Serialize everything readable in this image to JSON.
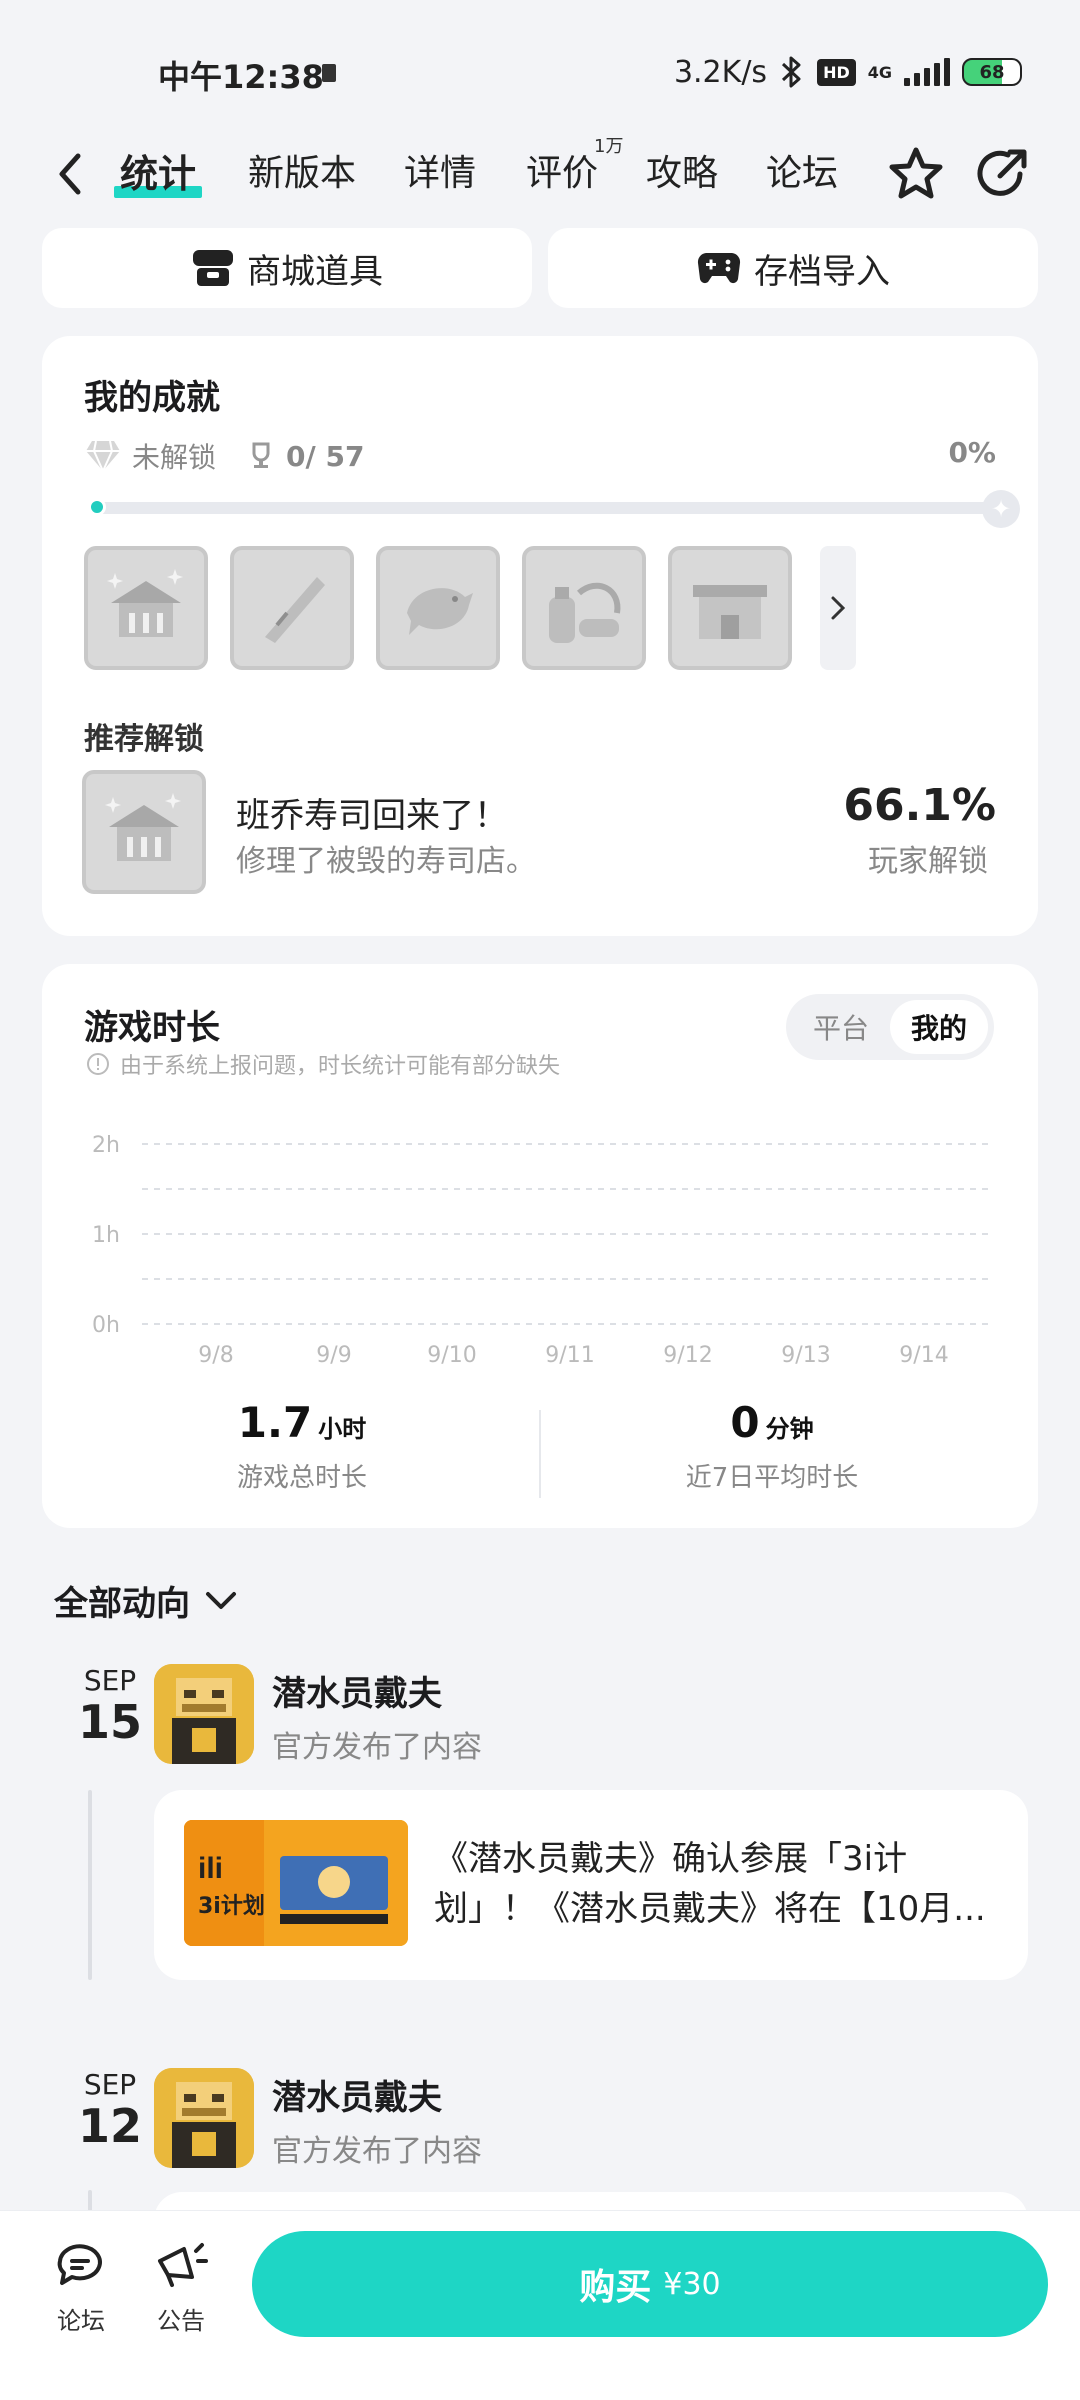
{
  "status": {
    "time": "中午12:38",
    "speed": "3.2K/s",
    "hd": "HD",
    "network": "4G",
    "battery": "68"
  },
  "nav": {
    "tabs": [
      {
        "label": "统计",
        "active": true
      },
      {
        "label": "新版本"
      },
      {
        "label": "详情"
      },
      {
        "label": "评价",
        "badge": "1万"
      },
      {
        "label": "攻略"
      },
      {
        "label": "论坛"
      }
    ]
  },
  "top_buttons": {
    "shop": "商城道具",
    "save_import": "存档导入"
  },
  "achievements": {
    "title": "我的成就",
    "locked_label": "未解锁",
    "count": "0/ 57",
    "percent": "0%",
    "progress": 0,
    "recommend_title": "推荐解锁",
    "recommend": {
      "name": "班乔寿司回来了！",
      "desc": "修理了被毁的寿司店。",
      "rate": "66.1%",
      "rate_label": "玩家解锁"
    }
  },
  "playtime": {
    "title": "游戏时长",
    "note": "由于系统上报问题，时长统计可能有部分缺失",
    "segments": [
      "平台",
      "我的"
    ],
    "active_segment": "我的",
    "total_value": "1.7",
    "total_unit": "小时",
    "total_label": "游戏总时长",
    "avg_value": "0",
    "avg_unit": "分钟",
    "avg_label": "近7日平均时长"
  },
  "chart_data": {
    "type": "bar",
    "categories": [
      "9/8",
      "9/9",
      "9/10",
      "9/11",
      "9/12",
      "9/13",
      "9/14"
    ],
    "values": [
      0,
      0,
      0,
      0,
      0,
      0,
      0
    ],
    "title": "",
    "xlabel": "",
    "ylabel": "",
    "y_ticks": [
      "0h",
      "1h",
      "2h"
    ],
    "ylim": [
      0,
      2
    ],
    "grid": true
  },
  "feed": {
    "filter_label": "全部动向",
    "items": [
      {
        "month": "SEP",
        "day": "15",
        "name": "潜水员戴夫",
        "sub": "官方发布了内容",
        "post_text": "《潜水员戴夫》确认参展「3i计划」！《潜水员戴夫》将在【10月...",
        "thumb_text": "3i计划"
      },
      {
        "month": "SEP",
        "day": "12",
        "name": "潜水员戴夫",
        "sub": "官方发布了内容"
      }
    ]
  },
  "bottom": {
    "forum": "论坛",
    "notice": "公告",
    "buy_label": "购买",
    "buy_price": "¥30"
  },
  "colors": {
    "accent": "#1ed6c5",
    "background": "#f3f4f7"
  }
}
